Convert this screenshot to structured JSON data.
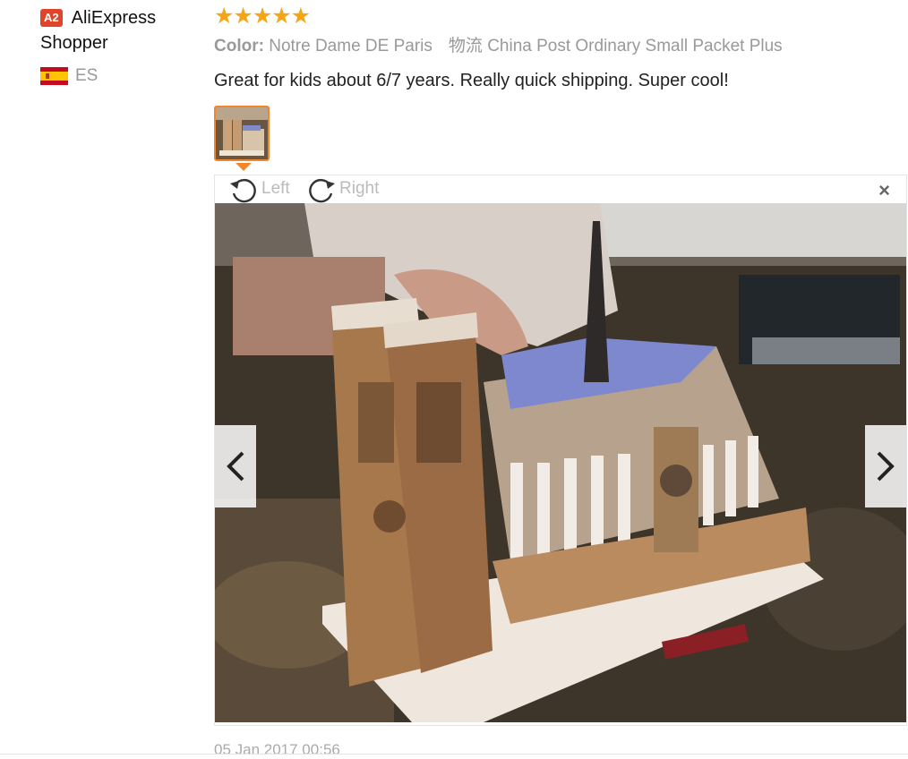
{
  "reviewer": {
    "level_badge": "A2",
    "name": "AliExpress Shopper",
    "country_code": "ES",
    "flag_icon": "spain-flag-icon"
  },
  "review": {
    "rating": 5,
    "stars_text": "★★★★★",
    "color_label": "Color:",
    "color_value": "Notre Dame DE Paris",
    "shipping_label": "物流",
    "shipping_value": "China Post Ordinary Small Packet Plus",
    "content": "Great for kids about 6/7 years. Really quick shipping. Super cool!",
    "date": "05 Jan 2017 00:56"
  },
  "viewer": {
    "rotate_left_label": "Left",
    "rotate_right_label": "Right",
    "close_label": "×",
    "prev_icon": "chevron-left-icon",
    "next_icon": "chevron-right-icon"
  },
  "colors": {
    "star": "#f6a514",
    "accent": "#f2862a",
    "badge": "#e0452b",
    "muted_text": "#999999"
  }
}
